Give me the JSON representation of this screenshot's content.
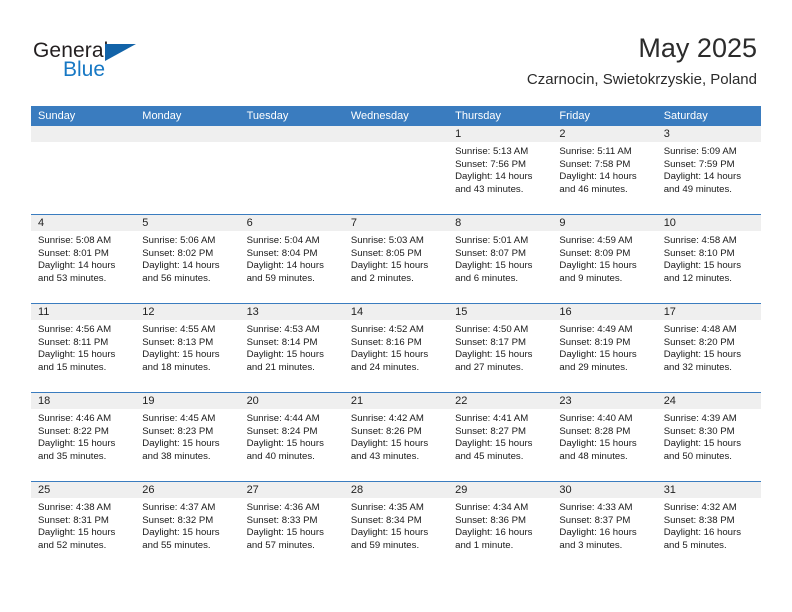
{
  "brand": {
    "name_top": "General",
    "name_bottom": "Blue",
    "triangle_color": "#1263a8",
    "blue_color": "#1778c4"
  },
  "header": {
    "title": "May 2025",
    "subtitle": "Czarnocin, Swietokrzyskie, Poland"
  },
  "theme": {
    "header_blue": "#3a7cbf",
    "day_number_bg": "#efefef",
    "text": "#1a1a1a"
  },
  "calendar": {
    "weekdays": [
      "Sunday",
      "Monday",
      "Tuesday",
      "Wednesday",
      "Thursday",
      "Friday",
      "Saturday"
    ],
    "weeks": [
      [
        {
          "day": "",
          "sunrise": "",
          "sunset": "",
          "daylight_1": "",
          "daylight_2": "",
          "empty": true
        },
        {
          "day": "",
          "sunrise": "",
          "sunset": "",
          "daylight_1": "",
          "daylight_2": "",
          "empty": true
        },
        {
          "day": "",
          "sunrise": "",
          "sunset": "",
          "daylight_1": "",
          "daylight_2": "",
          "empty": true
        },
        {
          "day": "",
          "sunrise": "",
          "sunset": "",
          "daylight_1": "",
          "daylight_2": "",
          "empty": true
        },
        {
          "day": "1",
          "sunrise": "Sunrise: 5:13 AM",
          "sunset": "Sunset: 7:56 PM",
          "daylight_1": "Daylight: 14 hours",
          "daylight_2": "and 43 minutes."
        },
        {
          "day": "2",
          "sunrise": "Sunrise: 5:11 AM",
          "sunset": "Sunset: 7:58 PM",
          "daylight_1": "Daylight: 14 hours",
          "daylight_2": "and 46 minutes."
        },
        {
          "day": "3",
          "sunrise": "Sunrise: 5:09 AM",
          "sunset": "Sunset: 7:59 PM",
          "daylight_1": "Daylight: 14 hours",
          "daylight_2": "and 49 minutes."
        }
      ],
      [
        {
          "day": "4",
          "sunrise": "Sunrise: 5:08 AM",
          "sunset": "Sunset: 8:01 PM",
          "daylight_1": "Daylight: 14 hours",
          "daylight_2": "and 53 minutes."
        },
        {
          "day": "5",
          "sunrise": "Sunrise: 5:06 AM",
          "sunset": "Sunset: 8:02 PM",
          "daylight_1": "Daylight: 14 hours",
          "daylight_2": "and 56 minutes."
        },
        {
          "day": "6",
          "sunrise": "Sunrise: 5:04 AM",
          "sunset": "Sunset: 8:04 PM",
          "daylight_1": "Daylight: 14 hours",
          "daylight_2": "and 59 minutes."
        },
        {
          "day": "7",
          "sunrise": "Sunrise: 5:03 AM",
          "sunset": "Sunset: 8:05 PM",
          "daylight_1": "Daylight: 15 hours",
          "daylight_2": "and 2 minutes."
        },
        {
          "day": "8",
          "sunrise": "Sunrise: 5:01 AM",
          "sunset": "Sunset: 8:07 PM",
          "daylight_1": "Daylight: 15 hours",
          "daylight_2": "and 6 minutes."
        },
        {
          "day": "9",
          "sunrise": "Sunrise: 4:59 AM",
          "sunset": "Sunset: 8:09 PM",
          "daylight_1": "Daylight: 15 hours",
          "daylight_2": "and 9 minutes."
        },
        {
          "day": "10",
          "sunrise": "Sunrise: 4:58 AM",
          "sunset": "Sunset: 8:10 PM",
          "daylight_1": "Daylight: 15 hours",
          "daylight_2": "and 12 minutes."
        }
      ],
      [
        {
          "day": "11",
          "sunrise": "Sunrise: 4:56 AM",
          "sunset": "Sunset: 8:11 PM",
          "daylight_1": "Daylight: 15 hours",
          "daylight_2": "and 15 minutes."
        },
        {
          "day": "12",
          "sunrise": "Sunrise: 4:55 AM",
          "sunset": "Sunset: 8:13 PM",
          "daylight_1": "Daylight: 15 hours",
          "daylight_2": "and 18 minutes."
        },
        {
          "day": "13",
          "sunrise": "Sunrise: 4:53 AM",
          "sunset": "Sunset: 8:14 PM",
          "daylight_1": "Daylight: 15 hours",
          "daylight_2": "and 21 minutes."
        },
        {
          "day": "14",
          "sunrise": "Sunrise: 4:52 AM",
          "sunset": "Sunset: 8:16 PM",
          "daylight_1": "Daylight: 15 hours",
          "daylight_2": "and 24 minutes."
        },
        {
          "day": "15",
          "sunrise": "Sunrise: 4:50 AM",
          "sunset": "Sunset: 8:17 PM",
          "daylight_1": "Daylight: 15 hours",
          "daylight_2": "and 27 minutes."
        },
        {
          "day": "16",
          "sunrise": "Sunrise: 4:49 AM",
          "sunset": "Sunset: 8:19 PM",
          "daylight_1": "Daylight: 15 hours",
          "daylight_2": "and 29 minutes."
        },
        {
          "day": "17",
          "sunrise": "Sunrise: 4:48 AM",
          "sunset": "Sunset: 8:20 PM",
          "daylight_1": "Daylight: 15 hours",
          "daylight_2": "and 32 minutes."
        }
      ],
      [
        {
          "day": "18",
          "sunrise": "Sunrise: 4:46 AM",
          "sunset": "Sunset: 8:22 PM",
          "daylight_1": "Daylight: 15 hours",
          "daylight_2": "and 35 minutes."
        },
        {
          "day": "19",
          "sunrise": "Sunrise: 4:45 AM",
          "sunset": "Sunset: 8:23 PM",
          "daylight_1": "Daylight: 15 hours",
          "daylight_2": "and 38 minutes."
        },
        {
          "day": "20",
          "sunrise": "Sunrise: 4:44 AM",
          "sunset": "Sunset: 8:24 PM",
          "daylight_1": "Daylight: 15 hours",
          "daylight_2": "and 40 minutes."
        },
        {
          "day": "21",
          "sunrise": "Sunrise: 4:42 AM",
          "sunset": "Sunset: 8:26 PM",
          "daylight_1": "Daylight: 15 hours",
          "daylight_2": "and 43 minutes."
        },
        {
          "day": "22",
          "sunrise": "Sunrise: 4:41 AM",
          "sunset": "Sunset: 8:27 PM",
          "daylight_1": "Daylight: 15 hours",
          "daylight_2": "and 45 minutes."
        },
        {
          "day": "23",
          "sunrise": "Sunrise: 4:40 AM",
          "sunset": "Sunset: 8:28 PM",
          "daylight_1": "Daylight: 15 hours",
          "daylight_2": "and 48 minutes."
        },
        {
          "day": "24",
          "sunrise": "Sunrise: 4:39 AM",
          "sunset": "Sunset: 8:30 PM",
          "daylight_1": "Daylight: 15 hours",
          "daylight_2": "and 50 minutes."
        }
      ],
      [
        {
          "day": "25",
          "sunrise": "Sunrise: 4:38 AM",
          "sunset": "Sunset: 8:31 PM",
          "daylight_1": "Daylight: 15 hours",
          "daylight_2": "and 52 minutes."
        },
        {
          "day": "26",
          "sunrise": "Sunrise: 4:37 AM",
          "sunset": "Sunset: 8:32 PM",
          "daylight_1": "Daylight: 15 hours",
          "daylight_2": "and 55 minutes."
        },
        {
          "day": "27",
          "sunrise": "Sunrise: 4:36 AM",
          "sunset": "Sunset: 8:33 PM",
          "daylight_1": "Daylight: 15 hours",
          "daylight_2": "and 57 minutes."
        },
        {
          "day": "28",
          "sunrise": "Sunrise: 4:35 AM",
          "sunset": "Sunset: 8:34 PM",
          "daylight_1": "Daylight: 15 hours",
          "daylight_2": "and 59 minutes."
        },
        {
          "day": "29",
          "sunrise": "Sunrise: 4:34 AM",
          "sunset": "Sunset: 8:36 PM",
          "daylight_1": "Daylight: 16 hours",
          "daylight_2": "and 1 minute."
        },
        {
          "day": "30",
          "sunrise": "Sunrise: 4:33 AM",
          "sunset": "Sunset: 8:37 PM",
          "daylight_1": "Daylight: 16 hours",
          "daylight_2": "and 3 minutes."
        },
        {
          "day": "31",
          "sunrise": "Sunrise: 4:32 AM",
          "sunset": "Sunset: 8:38 PM",
          "daylight_1": "Daylight: 16 hours",
          "daylight_2": "and 5 minutes."
        }
      ]
    ]
  }
}
